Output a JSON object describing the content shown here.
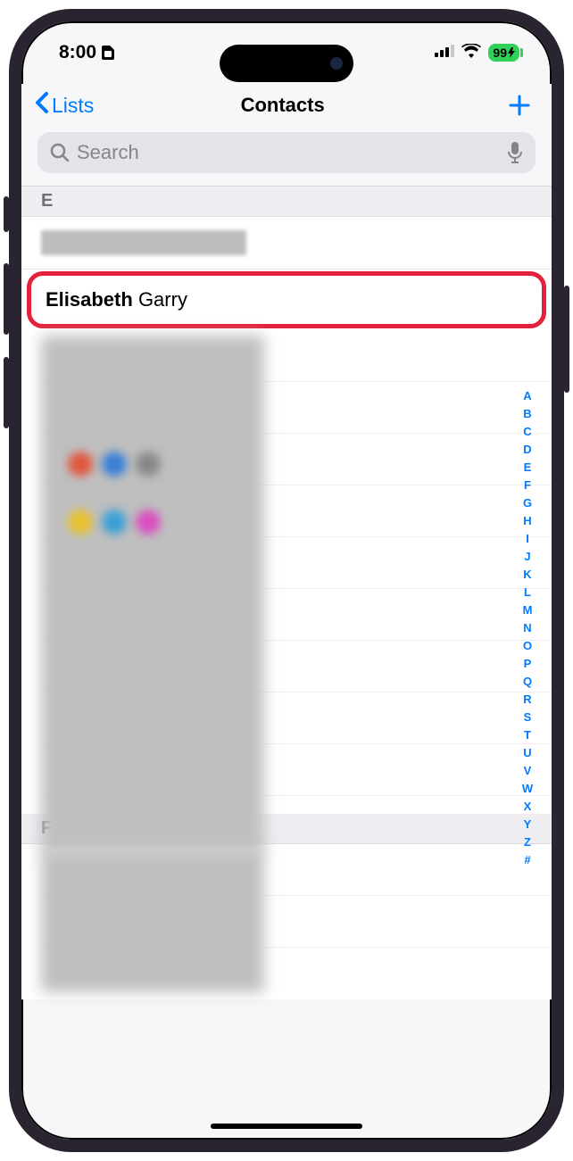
{
  "status": {
    "time": "8:00",
    "battery_pct": "99"
  },
  "nav": {
    "back_label": "Lists",
    "title": "Contacts"
  },
  "search": {
    "placeholder": "Search"
  },
  "sections": [
    {
      "letter": "E"
    },
    {
      "letter": "F"
    }
  ],
  "highlighted_contact": {
    "first": "Elisabeth",
    "last": "Garry"
  },
  "alpha_index": [
    "A",
    "B",
    "C",
    "D",
    "E",
    "F",
    "G",
    "H",
    "I",
    "J",
    "K",
    "L",
    "M",
    "N",
    "O",
    "P",
    "Q",
    "R",
    "S",
    "T",
    "U",
    "V",
    "W",
    "X",
    "Y",
    "Z",
    "#"
  ]
}
